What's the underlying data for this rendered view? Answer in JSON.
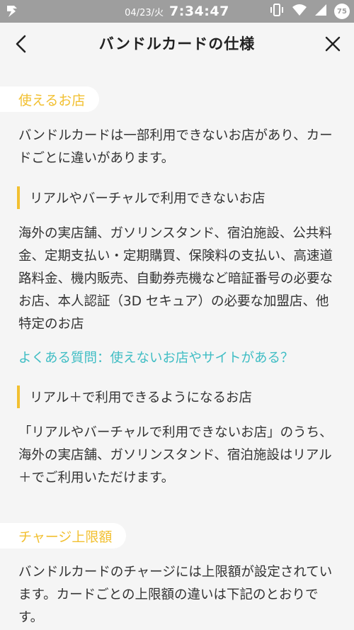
{
  "status_bar": {
    "date": "04/23/火",
    "time": "7:34:47",
    "battery": "75"
  },
  "nav": {
    "title": "バンドルカードの仕様"
  },
  "sections": {
    "stores": {
      "heading": "使えるお店",
      "intro": "バンドルカードは一部利用できないお店があり、カードごとに違いがあります。",
      "unusable_heading": "リアルやバーチャルで利用できないお店",
      "unusable_text": "海外の実店舗、ガソリンスタンド、宿泊施設、公共料金、定期支払い・定期購買、保険料の支払い、高速道路料金、機内販売、自動券売機など暗証番号の必要なお店、本人認証（3D セキュア）の必要な加盟店、他特定のお店",
      "faq_link": "よくある質問：使えないお店やサイトがある？",
      "real_plus_heading": "リアル＋で利用できるようになるお店",
      "real_plus_text": "「リアルやバーチャルで利用できないお店」のうち、海外の実店舗、ガソリンスタンド、宿泊施設はリアル＋でご利用いただけます。"
    },
    "charge": {
      "heading": "チャージ上限額",
      "text": "バンドルカードのチャージには上限額が設定されています。カードごとの上限額の違いは下記のとおりです。"
    }
  },
  "colors": {
    "accent": "#f2c031",
    "link": "#3fbdc4",
    "status_bar": "#9e9e9e"
  }
}
